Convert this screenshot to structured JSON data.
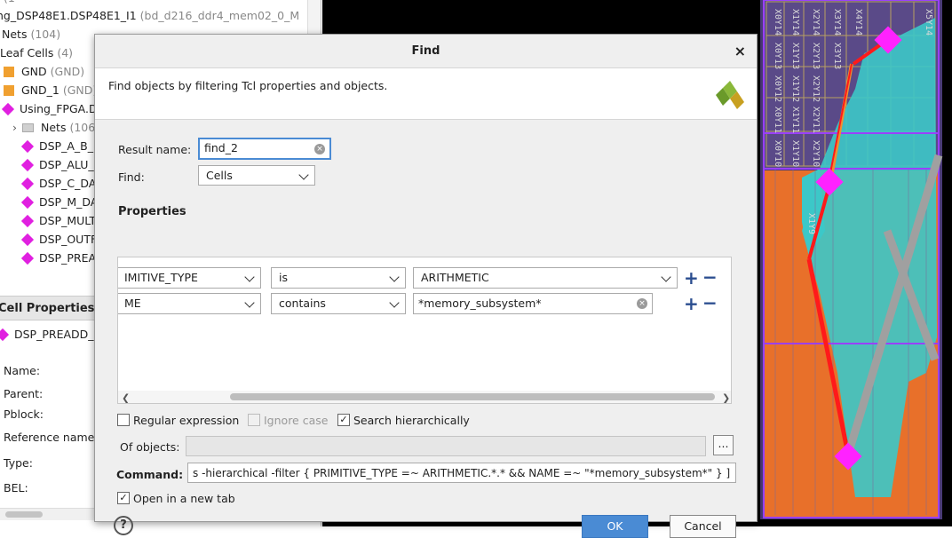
{
  "netlist": {
    "rows": [
      {
        "kind": "plain",
        "text": "ng_DSP48E1.DSP48E1_I1",
        "suffix": "(bd_d216_ddr4_mem02_0_M"
      },
      {
        "kind": "plain",
        "text": "Nets",
        "suffix": "(104)"
      },
      {
        "kind": "plain",
        "text": "Leaf Cells",
        "suffix": "(4)"
      },
      {
        "kind": "square",
        "text": "GND",
        "suffix": "(GND)"
      },
      {
        "kind": "square",
        "text": "GND_1",
        "suffix": "(GND)"
      },
      {
        "kind": "diamond",
        "text": "Using_FPGA.D",
        "suffix": ""
      },
      {
        "kind": "folder",
        "text": "Nets",
        "suffix": "(106"
      },
      {
        "kind": "diamond",
        "text": "DSP_A_B_D",
        "suffix": ""
      },
      {
        "kind": "diamond",
        "text": "DSP_ALU_I",
        "suffix": ""
      },
      {
        "kind": "diamond",
        "text": "DSP_C_DA",
        "suffix": ""
      },
      {
        "kind": "diamond",
        "text": "DSP_M_DA",
        "suffix": ""
      },
      {
        "kind": "diamond",
        "text": "DSP_MULT",
        "suffix": ""
      },
      {
        "kind": "diamond",
        "text": "DSP_OUTF",
        "suffix": ""
      },
      {
        "kind": "diamond",
        "text": "DSP_PREA",
        "suffix": ""
      }
    ],
    "top_fragment": "(1"
  },
  "cell_properties": {
    "title": "Cell Properties",
    "selected": "DSP_PREADD_D",
    "labels": [
      "Name:",
      "Parent:",
      "Pblock:",
      "Reference name",
      "Type:",
      "BEL:"
    ]
  },
  "device": {
    "tile_labels": [
      "X0Y14",
      "X1Y14",
      "X2Y14",
      "X3Y14",
      "X4Y14",
      "X5Y14",
      "X0Y13",
      "X1Y13",
      "X2Y13",
      "X3Y13",
      "X0Y12",
      "X1Y12",
      "X2Y12",
      "X0Y11",
      "X1Y11",
      "X2Y11",
      "X0Y10",
      "X1Y10",
      "X2Y10",
      "X1Y9"
    ]
  },
  "dialog": {
    "title": "Find",
    "description": "Find objects by filtering Tcl properties and objects.",
    "result_name_label": "Result name:",
    "result_name_value": "find_2",
    "find_label": "Find:",
    "find_value": "Cells",
    "properties_title": "Properties",
    "filters": [
      {
        "property": "IMITIVE_TYPE",
        "operator": "is",
        "value": "ARITHMETIC",
        "value_kind": "combo"
      },
      {
        "property": "ME",
        "operator": "contains",
        "value": "*memory_subsystem*",
        "value_kind": "text"
      }
    ],
    "regular_expression_label": "Regular expression",
    "regular_expression_checked": false,
    "ignore_case_label": "Ignore case",
    "ignore_case_checked": false,
    "search_hier_label": "Search hierarchically",
    "search_hier_checked": true,
    "of_objects_label": "Of objects:",
    "of_objects_value": "",
    "command_label": "Command:",
    "command_value": "s -hierarchical -filter { PRIMITIVE_TYPE =~ ARITHMETIC.*.* && NAME =~  \"*memory_subsystem*\" } ]",
    "open_new_tab_label": "Open in a new tab",
    "open_new_tab_checked": true,
    "ok_label": "OK",
    "cancel_label": "Cancel",
    "help_glyph": "?",
    "close_glyph": "×",
    "browse_glyph": "...",
    "plus_glyph": "+",
    "minus_glyph": "−"
  },
  "colors": {
    "accent": "#4a8bd4",
    "diamond": "#e020e0",
    "cell_square": "#f0a030",
    "plus_minus": "#2a4d8f"
  }
}
